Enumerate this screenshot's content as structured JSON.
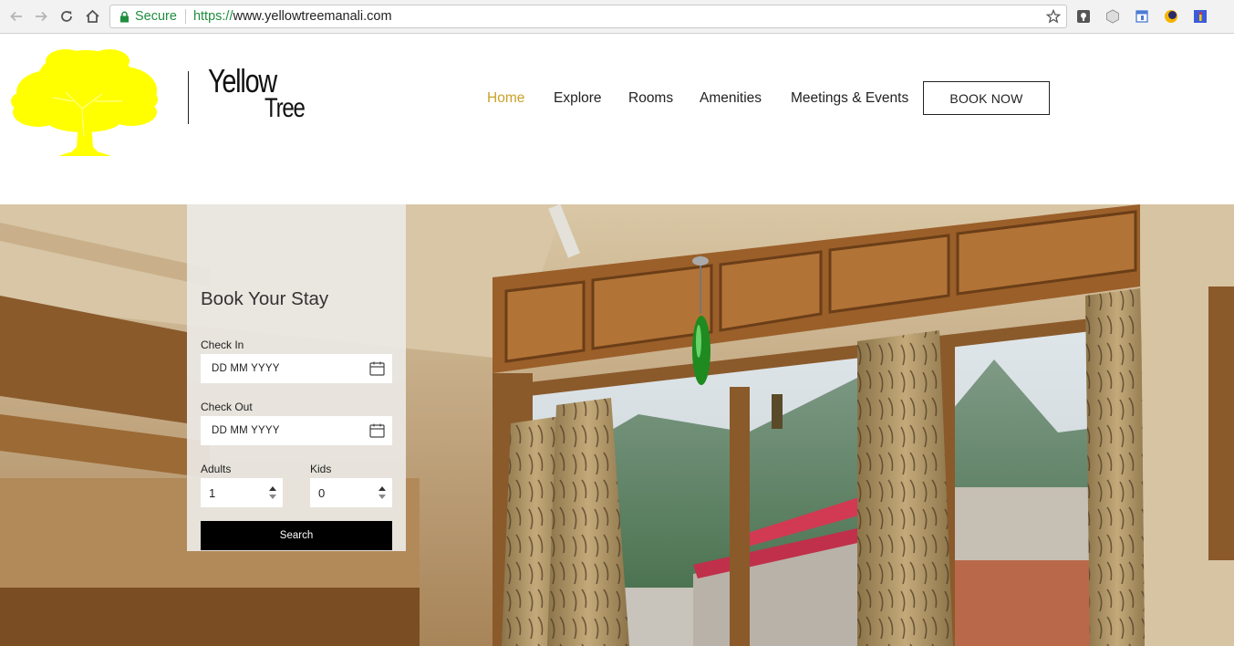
{
  "browser": {
    "secure_label": "Secure",
    "url_scheme": "https://",
    "url_host": "www.yellowtreemanali.com",
    "icons": [
      "back-icon",
      "forward-icon",
      "reload-icon",
      "home-icon",
      "lock-icon",
      "bookmark-star-icon"
    ],
    "extensions": [
      "extension-1-icon",
      "extension-2-icon",
      "extension-3-icon",
      "extension-4-icon",
      "extension-5-icon"
    ]
  },
  "header": {
    "brand_line1": "Yellow",
    "brand_line2": "Tree",
    "nav": [
      {
        "label": "Home",
        "active": true
      },
      {
        "label": "Explore",
        "active": false
      },
      {
        "label": "Rooms",
        "active": false
      },
      {
        "label": "Amenities",
        "active": false
      },
      {
        "label": "Meetings & Events",
        "active": false
      }
    ],
    "book_now": "BOOK NOW"
  },
  "booking": {
    "title": "Book Your Stay",
    "check_in_label": "Check In",
    "check_in_value": "DD MM YYYY",
    "check_out_label": "Check Out",
    "check_out_value": "DD MM YYYY",
    "adults_label": "Adults",
    "adults_value": "1",
    "kids_label": "Kids",
    "kids_value": "0",
    "search_label": "Search"
  },
  "colors": {
    "accent_active": "#c9a227",
    "logo_yellow": "#ffff00",
    "secure_green": "#1e8e3e"
  }
}
